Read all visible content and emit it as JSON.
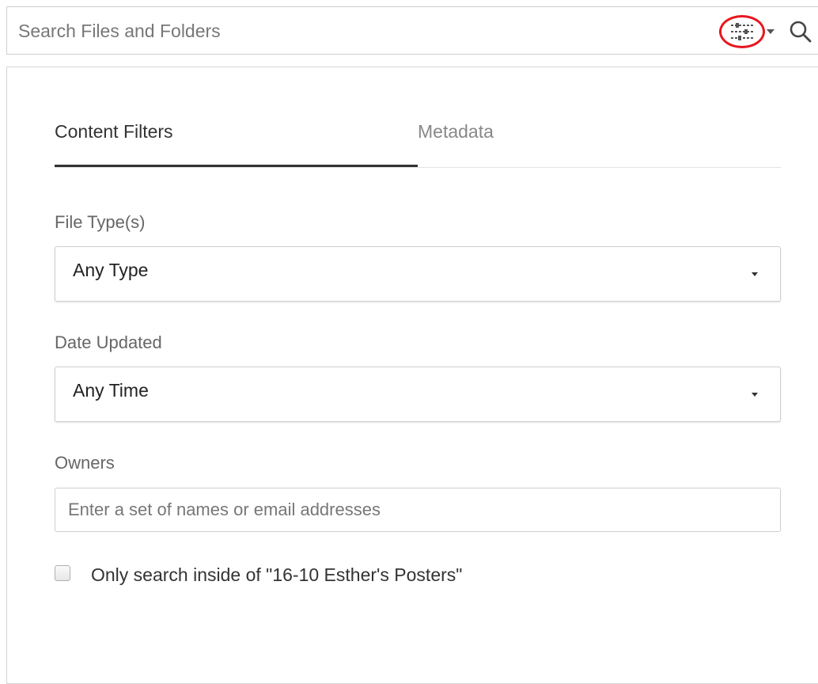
{
  "search": {
    "placeholder": "Search Files and Folders",
    "value": ""
  },
  "toolbar": {
    "filter_icon": "sliders-icon",
    "dropdown_icon": "caret-down-icon",
    "search_icon": "magnifier-icon",
    "highlight_color": "#e8161f"
  },
  "tabs": [
    {
      "label": "Content Filters",
      "active": true
    },
    {
      "label": "Metadata",
      "active": false
    }
  ],
  "filters": {
    "file_type": {
      "label": "File Type(s)",
      "selected": "Any Type"
    },
    "date_updated": {
      "label": "Date Updated",
      "selected": "Any Time"
    },
    "owners": {
      "label": "Owners",
      "placeholder": "Enter a set of names or email addresses",
      "value": ""
    },
    "scope_checkbox": {
      "label": "Only search inside of \"16-10 Esther's Posters\"",
      "checked": false
    }
  }
}
